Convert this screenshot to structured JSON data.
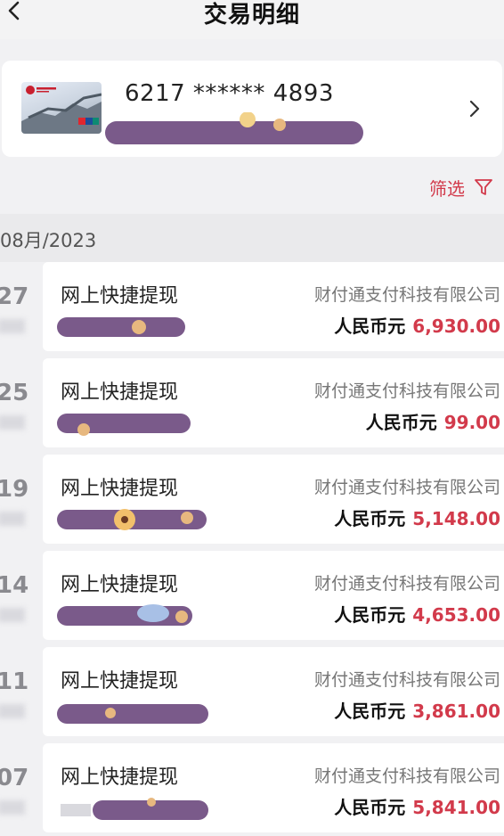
{
  "header": {
    "title": "交易明细",
    "back_icon": "chevron-left-icon"
  },
  "card": {
    "number": "6217 ****** 4893",
    "bank_image": "bank-card-image",
    "chevron": "chevron-right-icon"
  },
  "filter": {
    "label": "筛选",
    "icon": "filter-icon",
    "color": "#d23a4b"
  },
  "month": {
    "label": "08月/2023"
  },
  "transactions": [
    {
      "day": "27",
      "type": "网上快捷提现",
      "merchant": "财付通支付科技有限公司",
      "currency": "人民币元",
      "amount": "6,930.00"
    },
    {
      "day": "25",
      "type": "网上快捷提现",
      "merchant": "财付通支付科技有限公司",
      "currency": "人民币元",
      "amount": "99.00"
    },
    {
      "day": "19",
      "type": "网上快捷提现",
      "merchant": "财付通支付科技有限公司",
      "currency": "人民币元",
      "amount": "5,148.00"
    },
    {
      "day": "14",
      "type": "网上快捷提现",
      "merchant": "财付通支付科技有限公司",
      "currency": "人民币元",
      "amount": "4,653.00"
    },
    {
      "day": "11",
      "type": "网上快捷提现",
      "merchant": "财付通支付科技有限公司",
      "currency": "人民币元",
      "amount": "3,861.00"
    },
    {
      "day": "07",
      "type": "网上快捷提现",
      "merchant": "财付通支付科技有限公司",
      "currency": "人民币元",
      "amount": "5,841.00"
    }
  ]
}
